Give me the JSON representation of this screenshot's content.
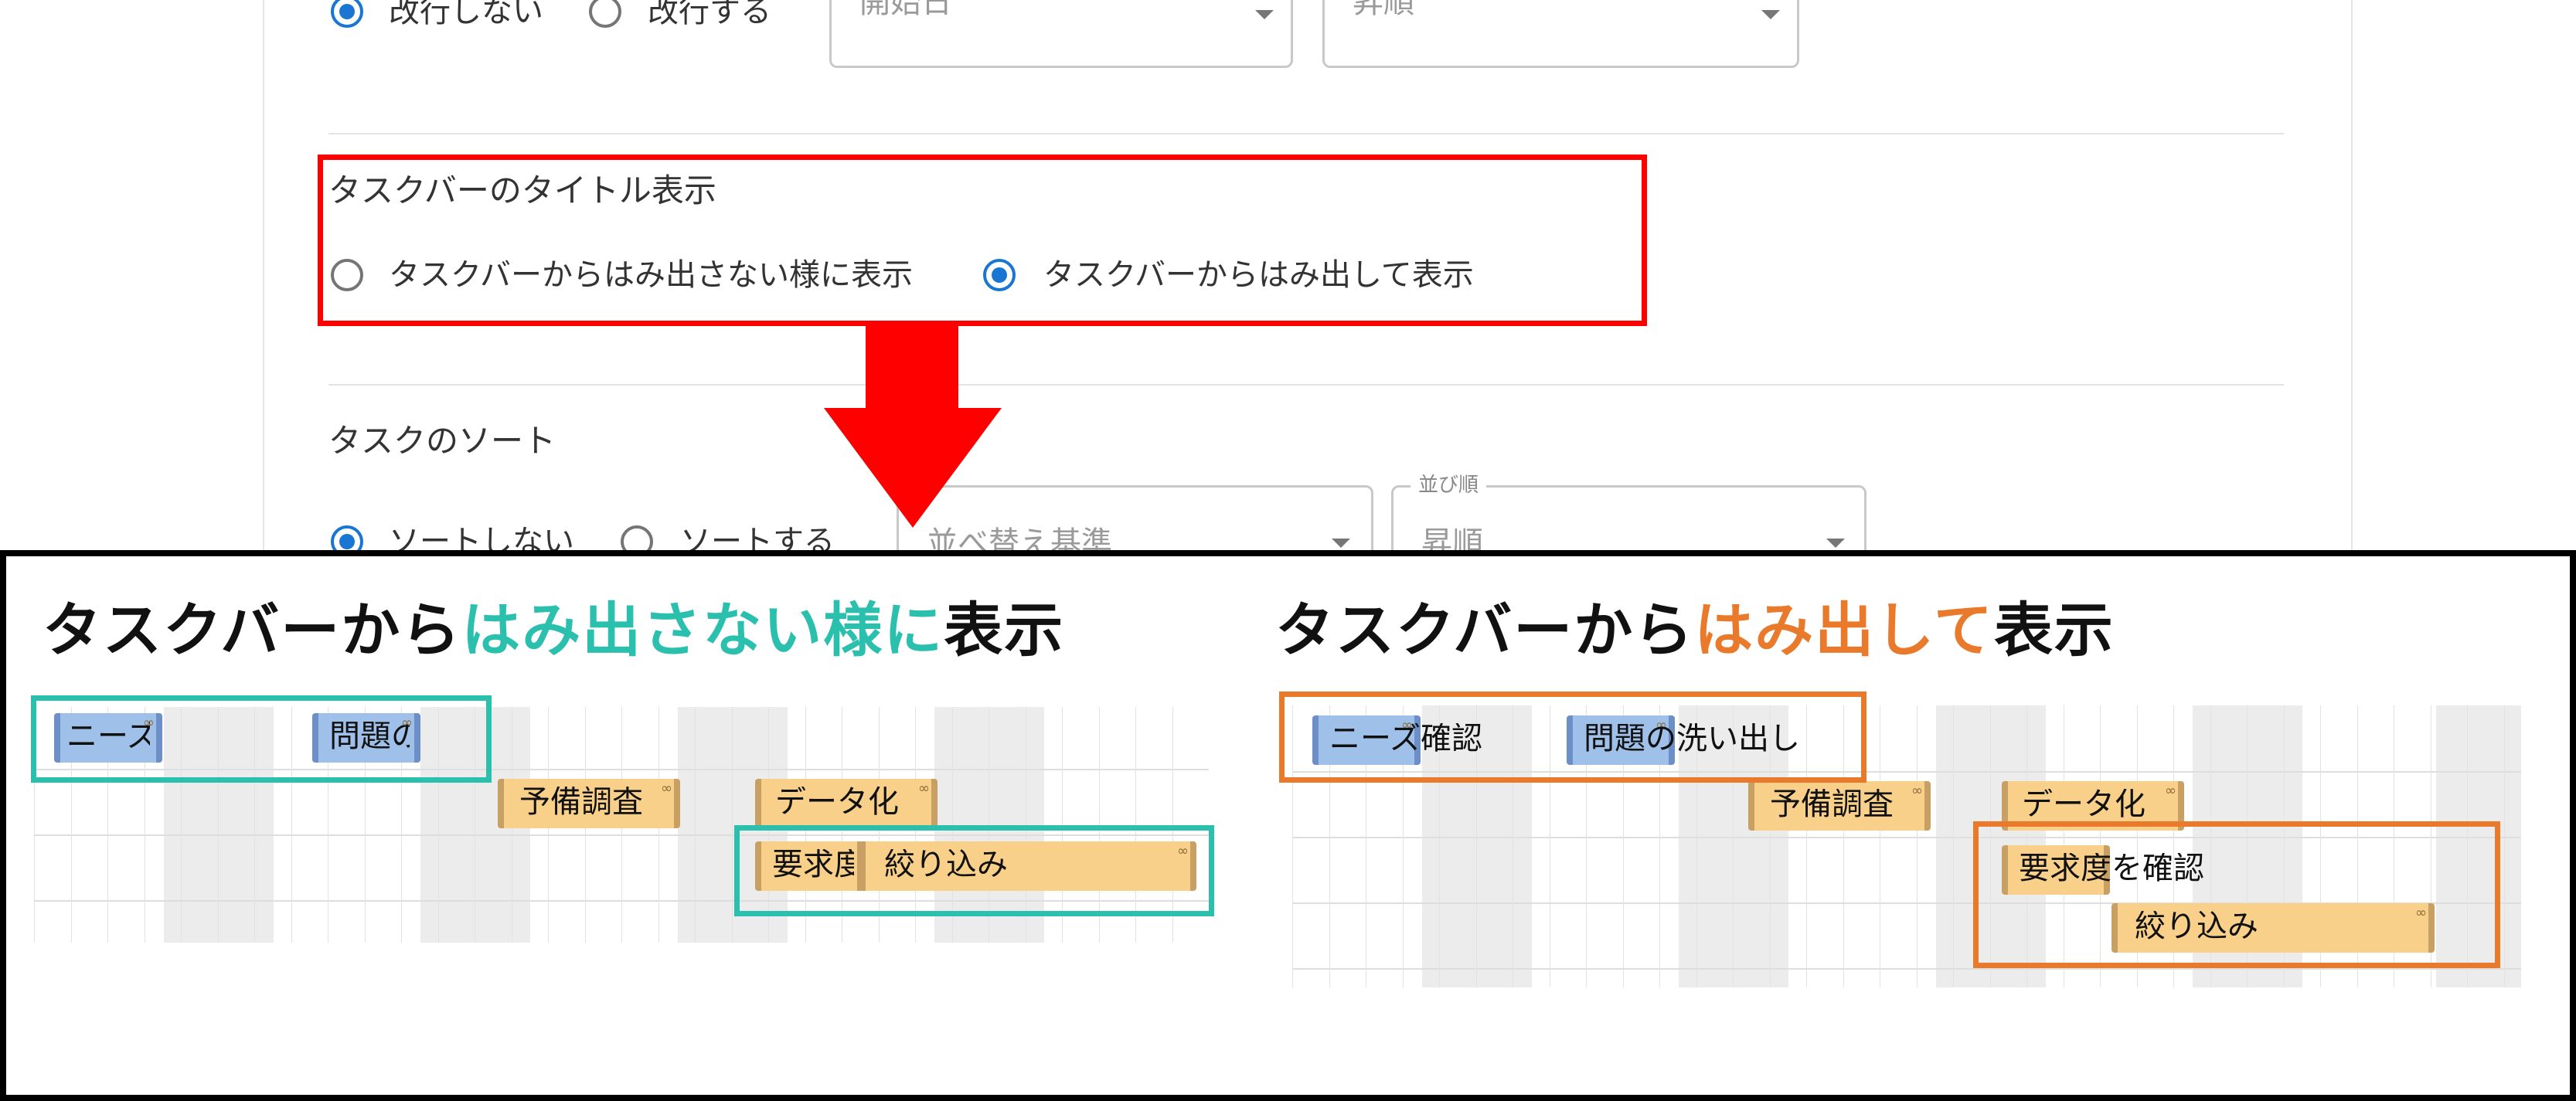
{
  "settings": {
    "wrap": {
      "no_wrap_label": "改行しない",
      "wrap_label": "改行する"
    },
    "wrap_selects": {
      "field_value": "開始日",
      "order_value": "昇順"
    },
    "title_display": {
      "title": "タスクバーのタイトル表示",
      "inside_label": "タスクバーからはみ出さない様に表示",
      "outside_label": "タスクバーからはみ出して表示",
      "selected": "outside"
    },
    "sort": {
      "title": "タスクのソート",
      "no_sort_label": "ソートしない",
      "sort_label": "ソートする",
      "sort_by_placeholder": "並べ替え基準",
      "order_legend": "並び順",
      "order_value": "昇順"
    }
  },
  "comparison": {
    "left_heading": {
      "pre": "タスクバーから",
      "highlight": "はみ出さない様に",
      "post": "表示"
    },
    "right_heading": {
      "pre": "タスクバーから",
      "highlight": "はみ出して",
      "post": "表示"
    },
    "left_tasks": {
      "t1": "ニーズ",
      "t2": "問題の",
      "t3": "予備調査",
      "t4": "データ化",
      "t5": "要求度",
      "t6": "絞り込み"
    },
    "right_tasks": {
      "t1": "ニーズ確認",
      "t2": "問題の洗い出し",
      "t3": "予備調査",
      "t4": "データ化",
      "t5": "要求度を確認",
      "t6": "絞り込み"
    }
  },
  "colors": {
    "highlight_red": "#ff0000",
    "teal": "#2bbfae",
    "orange": "#ea7a2b",
    "radio_blue": "#1976d2",
    "bar_blue": "#9fc0e8",
    "bar_orange": "#f8d08a"
  },
  "icons": [
    "arrow-down-icon",
    "chevron-down-icon",
    "link-icon"
  ]
}
